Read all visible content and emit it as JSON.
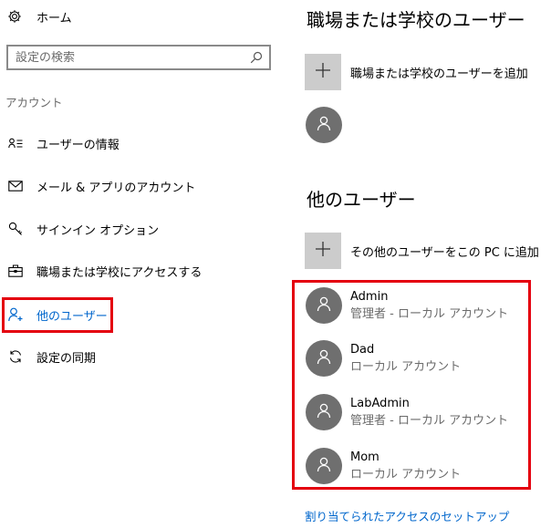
{
  "sidebar": {
    "home_label": "ホーム",
    "search_placeholder": "設定の検索",
    "section_label": "アカウント",
    "items": [
      {
        "label": "ユーザーの情報",
        "icon": "user-info-icon"
      },
      {
        "label": "メール & アプリのアカウント",
        "icon": "mail-icon"
      },
      {
        "label": "サインイン オプション",
        "icon": "key-icon"
      },
      {
        "label": "職場または学校にアクセスする",
        "icon": "briefcase-icon"
      },
      {
        "label": "他のユーザー",
        "icon": "add-person-icon",
        "active": true
      },
      {
        "label": "設定の同期",
        "icon": "sync-icon"
      }
    ]
  },
  "main": {
    "work_school_heading": "職場または学校のユーザー",
    "add_work_school_label": "職場または学校のユーザーを追加",
    "other_users_heading": "他のユーザー",
    "add_other_user_label": "その他のユーザーをこの PC に追加",
    "users": [
      {
        "name": "Admin",
        "role": "管理者 - ローカル アカウント"
      },
      {
        "name": "Dad",
        "role": "ローカル アカウント"
      },
      {
        "name": "LabAdmin",
        "role": "管理者 - ローカル アカウント"
      },
      {
        "name": "Mom",
        "role": "ローカル アカウント"
      }
    ],
    "assigned_access_link": "割り当てられたアクセスのセットアップ"
  },
  "colors": {
    "accent": "#0066cc",
    "highlight": "#e4000f",
    "avatar_bg": "#6f6f6f",
    "tile_bg": "#cccccc"
  }
}
